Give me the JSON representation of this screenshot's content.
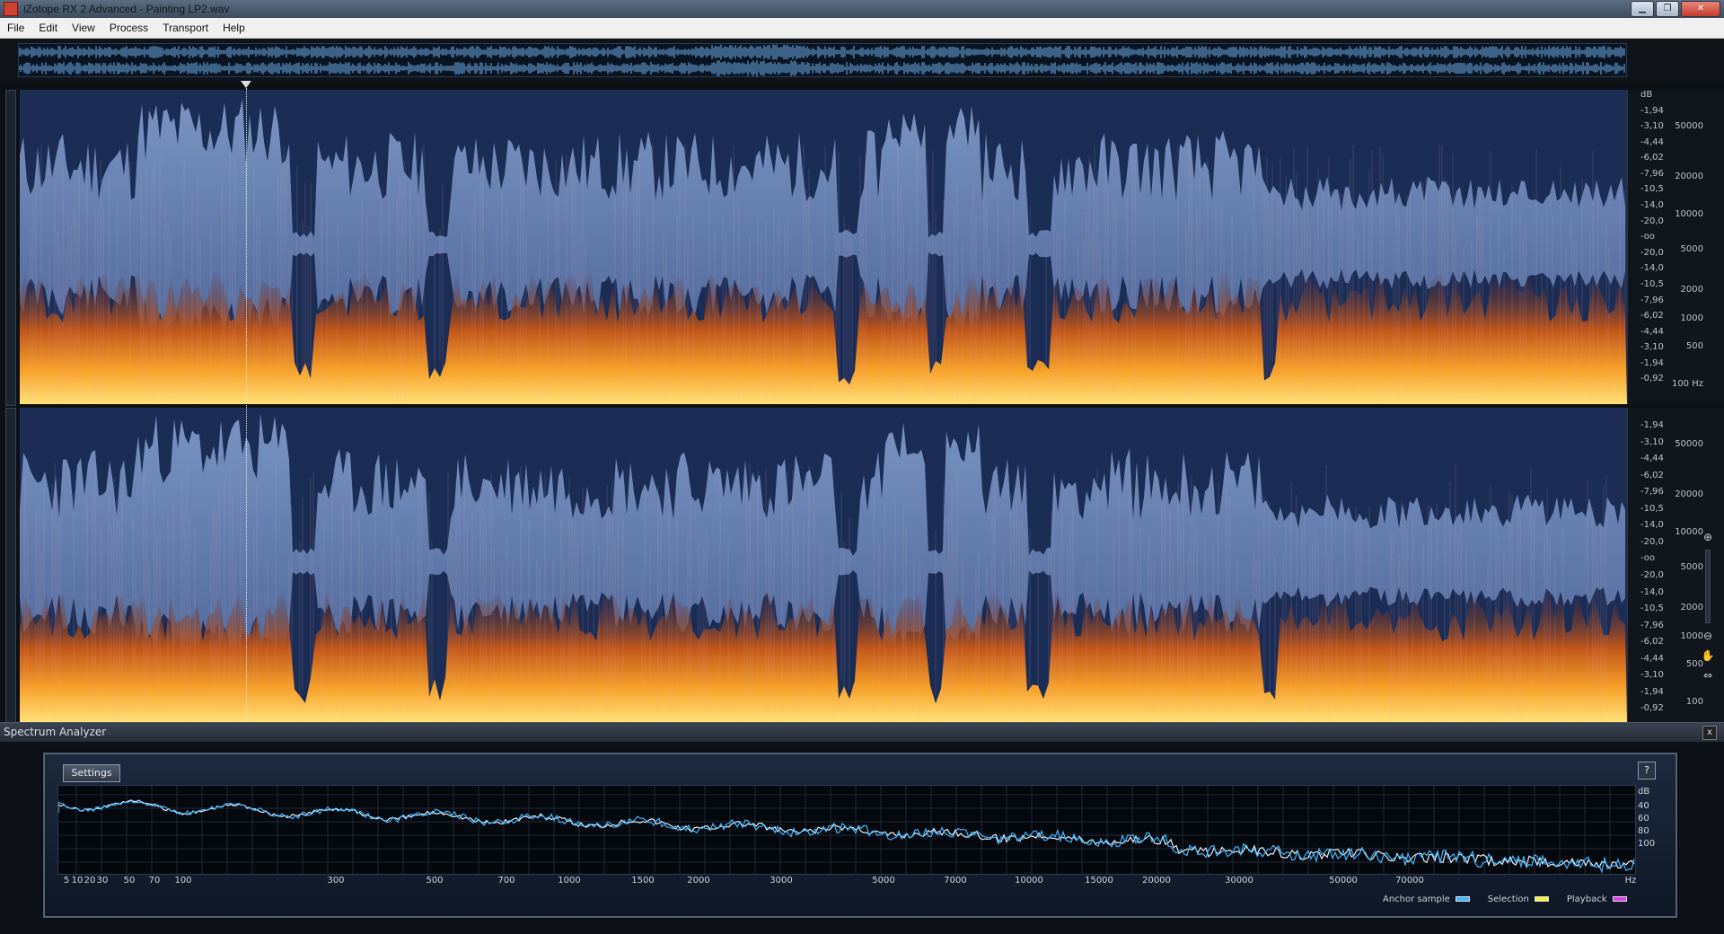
{
  "window": {
    "title": "iZotope RX 2 Advanced - Painting LP2.wav"
  },
  "menu": [
    {
      "label": "File"
    },
    {
      "label": "Edit"
    },
    {
      "label": "View"
    },
    {
      "label": "Process"
    },
    {
      "label": "Transport"
    },
    {
      "label": "Help"
    }
  ],
  "spectrogram": {
    "db_labels": [
      "dB",
      "-1,94",
      "-3,10",
      "-4,44",
      "-6,02",
      "-7,96",
      "-10,5",
      "-14,0",
      "-20,0",
      "-oo",
      "-20,0",
      "-14,0",
      "-10,5",
      "-7,96",
      "-6,02",
      "-4,44",
      "-3,10",
      "-1,94",
      "-0,92"
    ],
    "db_labels_lower": [
      "-1,94",
      "-3,10",
      "-4,44",
      "-6,02",
      "-7,96",
      "-10,5",
      "-14,0",
      "-20,0",
      "-oo",
      "-20,0",
      "-14,0",
      "-10,5",
      "-7,96",
      "-6,02",
      "-4,44",
      "-3,10",
      "-1,94",
      "-0,92"
    ],
    "hz_labels": [
      "50000",
      "20000",
      "10000",
      "5000",
      "2000",
      "1000",
      "500",
      "100 Hz"
    ],
    "hz_labels_lower": [
      "50000",
      "20000",
      "10000",
      "5000",
      "2000",
      "1000",
      "500",
      "100"
    ]
  },
  "analyzer": {
    "title": "Spectrum Analyzer",
    "settings_label": "Settings",
    "help_label": "?",
    "close_label": "x",
    "db_labels": [
      "dB",
      "40",
      "60",
      "80",
      "100"
    ],
    "x_labels": [
      "5",
      "10",
      "20",
      "30",
      "50",
      "70",
      "100",
      "300",
      "500",
      "700",
      "1000",
      "1500",
      "2000",
      "3000",
      "5000",
      "7000",
      "10000",
      "15000",
      "20000",
      "30000",
      "50000",
      "70000",
      "Hz"
    ],
    "legend": [
      {
        "label": "Anchor sample",
        "color": "#3fb6ff"
      },
      {
        "label": "Selection",
        "color": "#f5f23a"
      },
      {
        "label": "Playback",
        "color": "#e23cf0"
      }
    ]
  },
  "colors": {
    "spectrogram_bg": "#1b2c55",
    "heat": "#f08a1c",
    "waveform": "#6f8fc5"
  }
}
